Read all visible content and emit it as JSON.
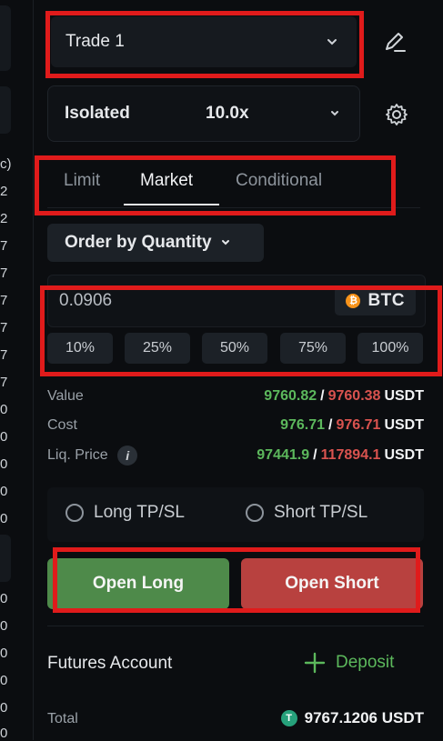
{
  "left_strip": {
    "values": [
      "c)",
      "2",
      "2",
      "7",
      "7",
      "7",
      "7",
      "7",
      "7",
      "0",
      "0",
      "0",
      "0",
      "0",
      "0",
      "0",
      "0",
      "0",
      "0",
      "0"
    ]
  },
  "trade_selector": {
    "label": "Trade 1"
  },
  "margin": {
    "mode": "Isolated",
    "leverage": "10.0x"
  },
  "tabs": [
    {
      "label": "Limit",
      "active": false
    },
    {
      "label": "Market",
      "active": true
    },
    {
      "label": "Conditional",
      "active": false
    }
  ],
  "order_type": {
    "label": "Order by Quantity"
  },
  "quantity": {
    "value": "0.0906",
    "coin": "BTC"
  },
  "percent_buttons": [
    "10%",
    "25%",
    "50%",
    "75%",
    "100%"
  ],
  "info": {
    "value": {
      "label": "Value",
      "long": "9760.82",
      "sep": "/",
      "short": "9760.38",
      "unit": "USDT"
    },
    "cost": {
      "label": "Cost",
      "long": "976.71",
      "sep": "/",
      "short": "976.71",
      "unit": "USDT"
    },
    "liq": {
      "label": "Liq. Price",
      "badge": "i",
      "long": "97441.9",
      "sep": "/",
      "short": "117894.1",
      "unit": "USDT"
    }
  },
  "tpsl": {
    "long_label": "Long TP/SL",
    "short_label": "Short TP/SL"
  },
  "actions": {
    "open_long": "Open Long",
    "open_short": "Open Short"
  },
  "account": {
    "title": "Futures Account",
    "deposit_label": "Deposit",
    "total_label": "Total",
    "total_value": "9767.1206 USDT",
    "usdt_symbol": "T"
  },
  "colors": {
    "green": "#5cb85c",
    "red": "#d9534f",
    "highlight": "#e01b1b"
  }
}
